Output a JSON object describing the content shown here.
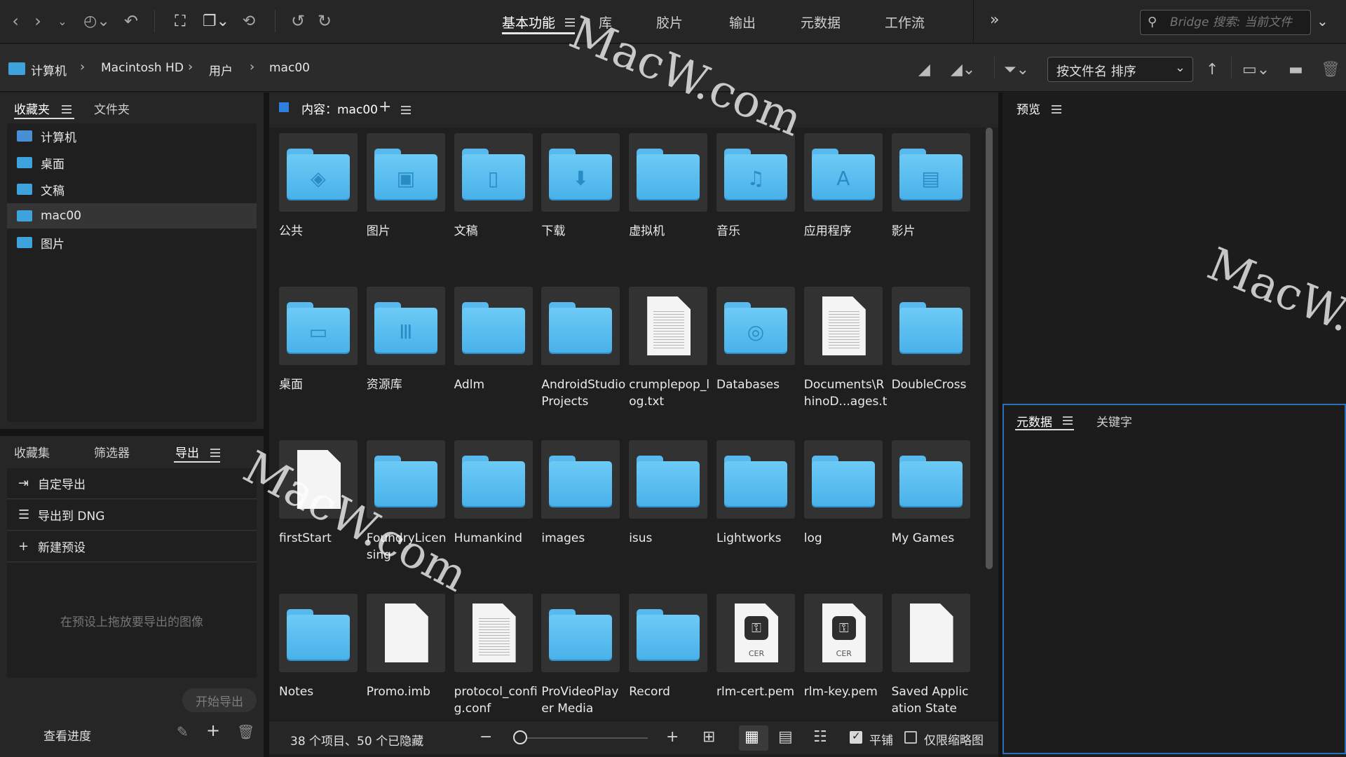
{
  "topbar": {
    "workspaces": [
      {
        "label": "基本功能",
        "active": true
      },
      {
        "label": "库",
        "active": false
      },
      {
        "label": "胶片",
        "active": false
      },
      {
        "label": "输出",
        "active": false
      },
      {
        "label": "元数据",
        "active": false
      },
      {
        "label": "工作流",
        "active": false
      }
    ],
    "more_glyph": "»",
    "search_placeholder": "Bridge 搜索: 当前文件"
  },
  "pathbar": {
    "crumbs": [
      "计算机",
      "Macintosh HD",
      "用户",
      "mac00"
    ],
    "sort_label": "按文件名 排序"
  },
  "favorites_panel": {
    "tabs": [
      "收藏夹",
      "文件夹"
    ],
    "items": [
      {
        "label": "计算机",
        "icon": "computer-icon",
        "selected": false
      },
      {
        "label": "桌面",
        "icon": "folder-icon",
        "selected": false
      },
      {
        "label": "文稿",
        "icon": "folder-icon",
        "selected": false
      },
      {
        "label": "mac00",
        "icon": "home-folder-icon",
        "selected": true
      },
      {
        "label": "图片",
        "icon": "folder-icon",
        "selected": false
      }
    ]
  },
  "export_panel": {
    "tabs": [
      "收藏集",
      "筛选器",
      "导出"
    ],
    "rows": [
      {
        "label": "自定导出",
        "icon": "export-icon"
      },
      {
        "label": "导出到 DNG",
        "icon": "list-icon"
      },
      {
        "label": "新建预设",
        "icon": "plus-icon"
      }
    ],
    "drop_hint": "在预设上拖放要导出的图像",
    "start_button": "开始导出",
    "progress_label": "查看进度"
  },
  "content": {
    "header": "内容：mac00",
    "items": [
      {
        "label": "公共",
        "kind": "folder",
        "glyph": "◈"
      },
      {
        "label": "图片",
        "kind": "folder",
        "glyph": "▣"
      },
      {
        "label": "文稿",
        "kind": "folder",
        "glyph": "▯"
      },
      {
        "label": "下载",
        "kind": "folder",
        "glyph": "⬇"
      },
      {
        "label": "虚拟机",
        "kind": "folder",
        "glyph": ""
      },
      {
        "label": "音乐",
        "kind": "folder",
        "glyph": "♫"
      },
      {
        "label": "应用程序",
        "kind": "folder",
        "glyph": "A"
      },
      {
        "label": "影片",
        "kind": "folder",
        "glyph": "▤"
      },
      {
        "label": "桌面",
        "kind": "folder",
        "glyph": "▭"
      },
      {
        "label": "资源库",
        "kind": "folder",
        "glyph": "Ⅲ"
      },
      {
        "label": "Adlm",
        "kind": "folder",
        "glyph": ""
      },
      {
        "label": "AndroidStudioProjects",
        "kind": "folder",
        "glyph": ""
      },
      {
        "label": "crumplepop_log.txt",
        "kind": "text",
        "glyph": ""
      },
      {
        "label": "Databases",
        "kind": "folder",
        "glyph": "◎"
      },
      {
        "label": "Documents\\RhinoD...ages.txt",
        "kind": "text",
        "glyph": ""
      },
      {
        "label": "DoubleCross",
        "kind": "folder",
        "glyph": ""
      },
      {
        "label": "firstStart",
        "kind": "blank",
        "glyph": ""
      },
      {
        "label": "FoundryLicensing",
        "kind": "folder",
        "glyph": ""
      },
      {
        "label": "Humankind",
        "kind": "folder",
        "glyph": ""
      },
      {
        "label": "images",
        "kind": "folder",
        "glyph": ""
      },
      {
        "label": "isus",
        "kind": "folder",
        "glyph": ""
      },
      {
        "label": "Lightworks",
        "kind": "folder",
        "glyph": ""
      },
      {
        "label": "log",
        "kind": "folder",
        "glyph": ""
      },
      {
        "label": "My Games",
        "kind": "folder",
        "glyph": ""
      },
      {
        "label": "Notes",
        "kind": "folder",
        "glyph": ""
      },
      {
        "label": "Promo.imb",
        "kind": "blank",
        "glyph": ""
      },
      {
        "label": "protocol_config.conf",
        "kind": "text",
        "glyph": ""
      },
      {
        "label": "ProVideoPlayer Media",
        "kind": "folder",
        "glyph": ""
      },
      {
        "label": "Record",
        "kind": "folder",
        "glyph": ""
      },
      {
        "label": "rlm-cert.pem",
        "kind": "cert",
        "glyph": "CER"
      },
      {
        "label": "rlm-key.pem",
        "kind": "cert",
        "glyph": "CER"
      },
      {
        "label": "Saved Application State",
        "kind": "blank",
        "glyph": ""
      }
    ]
  },
  "statusbar": {
    "summary": "38 个项目、50 个已隐藏",
    "tile_label": "平铺",
    "thumb_only_label": "仅限缩略图"
  },
  "preview_panel": {
    "title": "预览"
  },
  "meta_panel": {
    "tabs": [
      "元数据",
      "关键字"
    ]
  },
  "watermarks": [
    "MacW.com",
    "MacW.com",
    "MacW.c"
  ]
}
